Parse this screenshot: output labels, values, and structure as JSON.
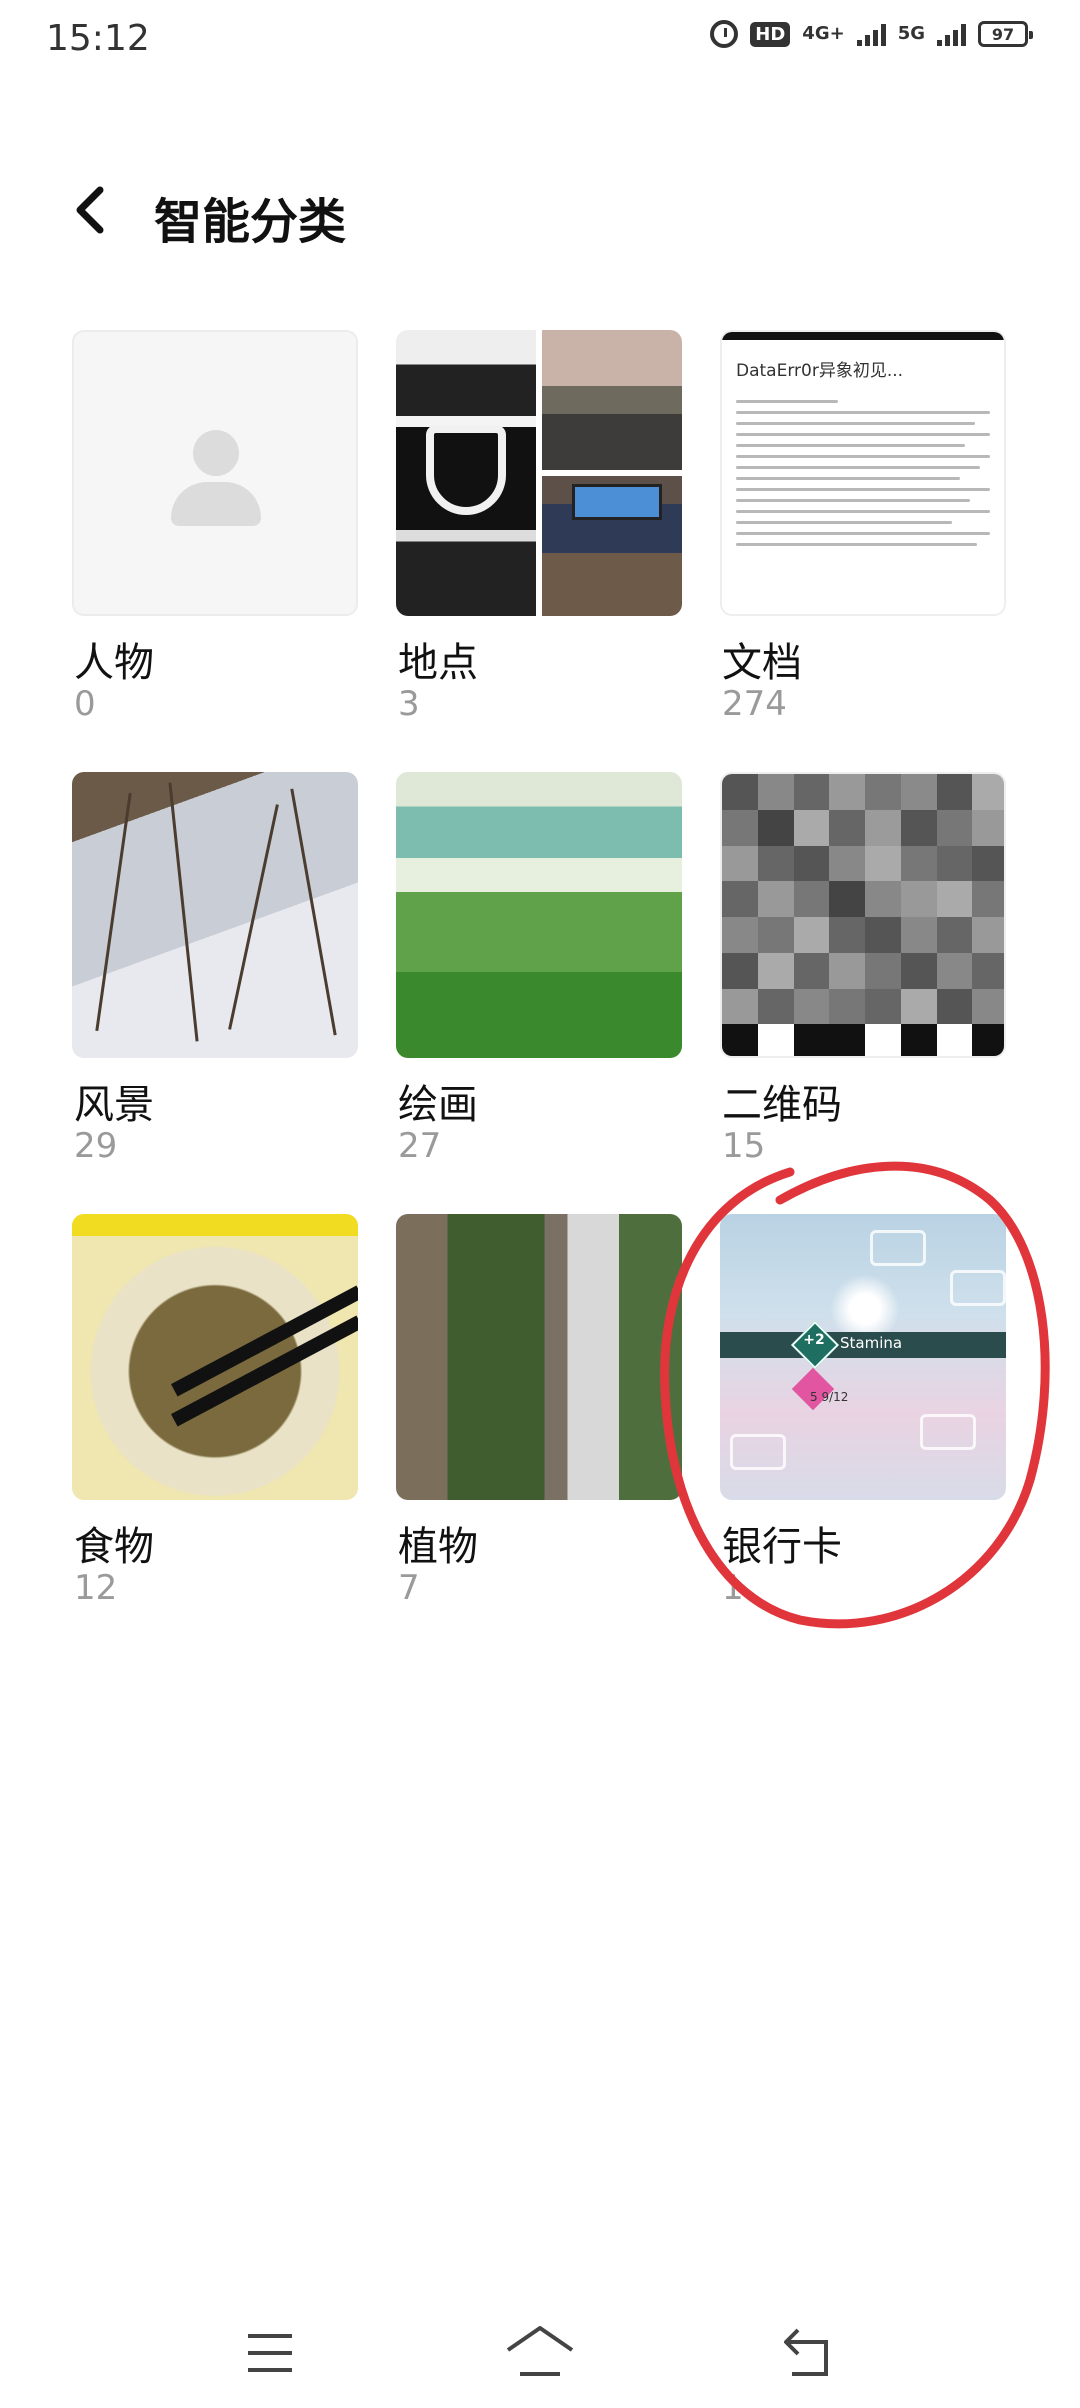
{
  "status_bar": {
    "time": "15:12",
    "hd_label": "HD",
    "net1": "4G+",
    "net2": "5G",
    "battery": "97"
  },
  "header": {
    "title": "智能分类"
  },
  "categories": [
    {
      "label": "人物",
      "count": "0"
    },
    {
      "label": "地点",
      "count": "3"
    },
    {
      "label": "文档",
      "count": "274"
    },
    {
      "label": "风景",
      "count": "29"
    },
    {
      "label": "绘画",
      "count": "27"
    },
    {
      "label": "二维码",
      "count": "15"
    },
    {
      "label": "食物",
      "count": "12"
    },
    {
      "label": "植物",
      "count": "7"
    },
    {
      "label": "银行卡",
      "count": "1"
    }
  ],
  "thumbnails": {
    "doc_title": "DataErr0r异象初见...",
    "card_badge": "+2",
    "card_label": "Stamina",
    "card_sub": "5 9/12"
  },
  "annotation": {
    "color": "#e0363b",
    "shape": "hand-drawn-circle"
  },
  "nav": {
    "icons": [
      "menu-icon",
      "home-icon",
      "back-icon"
    ]
  }
}
